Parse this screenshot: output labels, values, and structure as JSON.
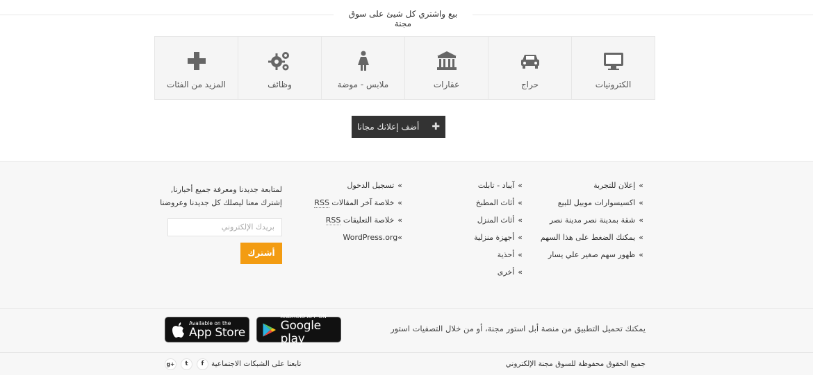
{
  "header": {
    "title": "بيع واشتري كل شيئ على سوق مجنة"
  },
  "categories": [
    {
      "label": "الكترونيات",
      "icon": "monitor-icon"
    },
    {
      "label": "حراج",
      "icon": "car-icon"
    },
    {
      "label": "عقارات",
      "icon": "bank-icon"
    },
    {
      "label": "ملابس - موضة",
      "icon": "female-icon"
    },
    {
      "label": "وظائف",
      "icon": "gears-icon"
    },
    {
      "label": "المزيد من الفئات",
      "icon": "plus-icon"
    }
  ],
  "add_button": {
    "label": "أضف إعلانك مجانا",
    "icon": "plus-icon"
  },
  "footer": {
    "col1": [
      "إعلان للتجربة",
      "اكسيسوارات موبيل للبيع",
      "شقة بمدينة نصر مدينة نصر",
      "يمكنك الضغط على هذا السهم",
      "ظهور سهم صغير علي يسار"
    ],
    "col2": [
      "آيباد - تابلت",
      "أثاث المطبخ",
      "أثاث المنزل",
      "أجهزة منزلية",
      "أحذية",
      "أخرى"
    ],
    "col3": {
      "login": "تسجيل الدخول",
      "posts_feed": "خلاصة آخر المقالات",
      "comments_feed": "خلاصة التعليقات",
      "rss": "RSS",
      "wordpress": "WordPress.org«"
    },
    "newsletter": {
      "line1": "لمتابعة جديدنا ومعرفة جميع أخبارنا,",
      "line2": "إشترك معنا ليصلك كل جديدنا وعروضنا",
      "email_placeholder": "بريدك الإلكتروني",
      "subscribe_label": "أشترك"
    }
  },
  "apps": {
    "text": "يمكنك تحميل التطبيق من منصة أبل استور مجنة، أو من خلال التصفيات استور",
    "google_small": "ANDROID APP ON",
    "google_big": "Google play",
    "apple_small": "Available on the",
    "apple_big": "App Store"
  },
  "bottom": {
    "copyright": "جميع الحقوق محفوظة للسوق مجنة الإلكتروني",
    "follow": "تابعنا على الشبكات الاجتماعية",
    "social": [
      "f",
      "t",
      "g+"
    ]
  }
}
